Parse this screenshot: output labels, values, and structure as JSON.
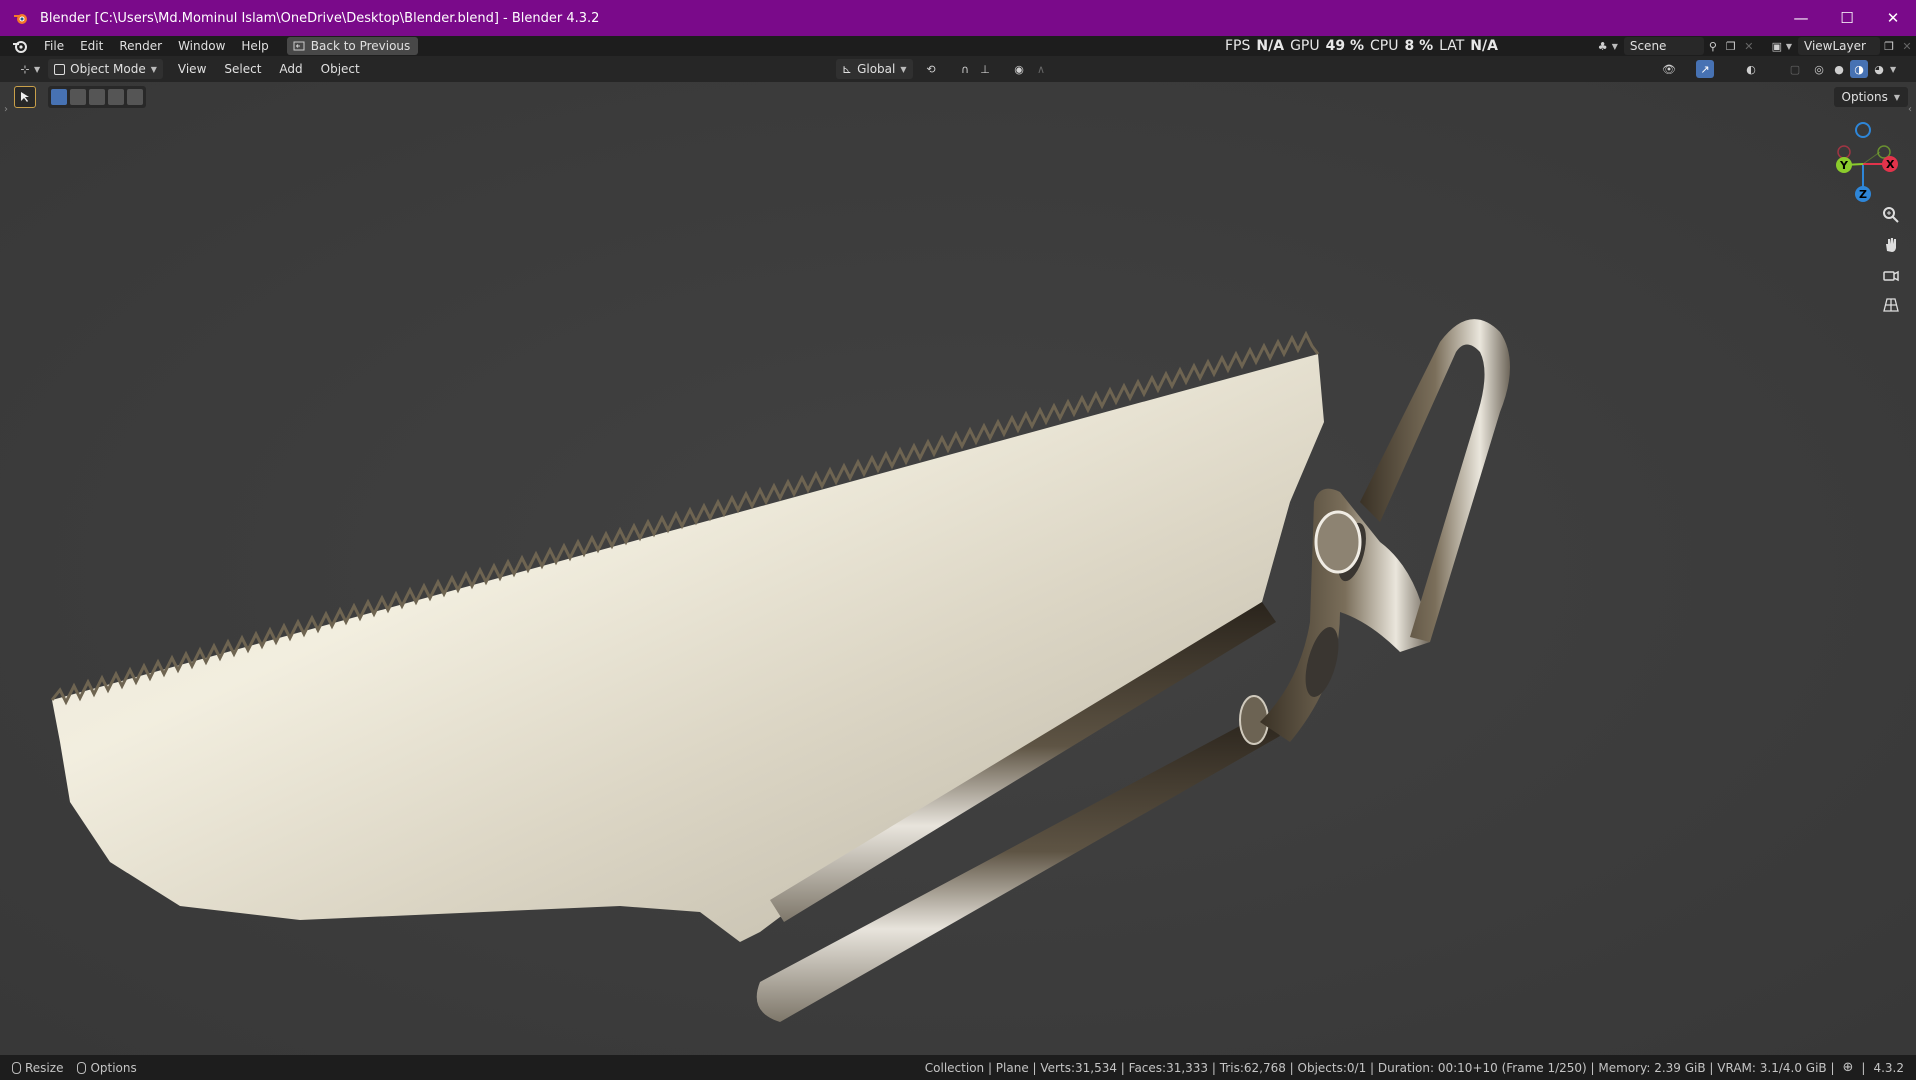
{
  "window": {
    "title": "Blender [C:\\Users\\Md.Mominul Islam\\OneDrive\\Desktop\\Blender.blend] - Blender 4.3.2",
    "app_icon": "blender-icon",
    "controls": {
      "minimize": "—",
      "maximize": "☐",
      "close": "✕"
    },
    "accent_color": "#7a0a8a"
  },
  "menubar": {
    "items": [
      "File",
      "Edit",
      "Render",
      "Window",
      "Help"
    ],
    "back_button": "Back to Previous"
  },
  "stats": {
    "fps_label": "FPS",
    "fps_value": "N/A",
    "gpu_label": "GPU",
    "gpu_value": "49 %",
    "cpu_label": "CPU",
    "cpu_value": "8 %",
    "lat_label": "LAT",
    "lat_value": "N/A"
  },
  "scene": {
    "name": "Scene",
    "view_layer": "ViewLayer"
  },
  "viewport_header": {
    "mode": "Object Mode",
    "menus": [
      "View",
      "Select",
      "Add",
      "Object"
    ],
    "transform_orientation": "Global",
    "options_label": "Options",
    "shading_active": "material-preview"
  },
  "statusbar": {
    "left": {
      "resize": "Resize",
      "options": "Options"
    },
    "info": "Collection | Plane | Verts:31,534 | Faces:31,333 | Tris:62,768 | Objects:0/1 | Duration: 00:10+10 (Frame 1/250) | Memory: 2.39 GiB | VRAM: 3.1/4.0 GiB |",
    "version": "4.3.2"
  },
  "gizmo": {
    "x_label": "X",
    "y_label": "Y",
    "z_label": "Z",
    "colors": {
      "x": "#e2334b",
      "y": "#8bcc2c",
      "z": "#2e86d8"
    }
  }
}
